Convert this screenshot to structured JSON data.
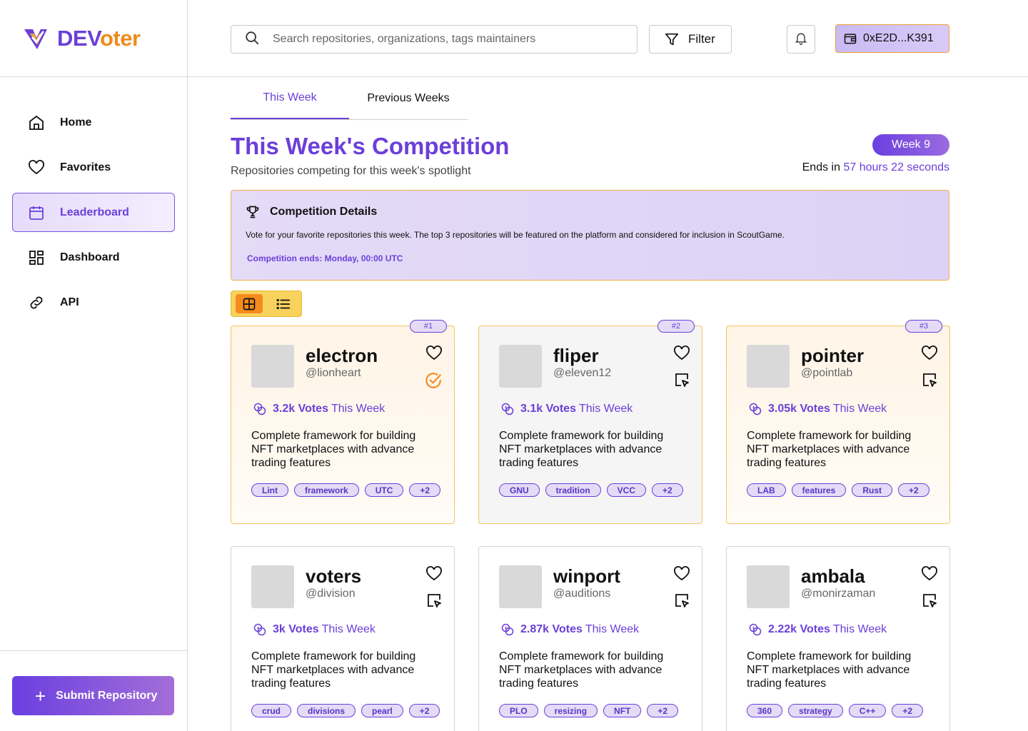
{
  "brand": {
    "name_part1": "DEV",
    "name_part2": "oter"
  },
  "sidebar": {
    "items": [
      {
        "label": "Home",
        "icon": "home-icon"
      },
      {
        "label": "Favorites",
        "icon": "heart-icon"
      },
      {
        "label": "Leaderboard",
        "icon": "calendar-icon",
        "active": true
      },
      {
        "label": "Dashboard",
        "icon": "dashboard-icon"
      },
      {
        "label": "API",
        "icon": "link-icon"
      }
    ],
    "submit_label": "Submit Repository"
  },
  "header": {
    "search_placeholder": "Search repositories, organizations, tags maintainers",
    "filter_label": "Filter",
    "wallet_address": "0xE2D...K391"
  },
  "tabs": [
    {
      "label": "This Week",
      "active": true
    },
    {
      "label": "Previous Weeks"
    }
  ],
  "competition": {
    "title": "This Week's Competition",
    "subtitle": "Repositories competing for this week's spotlight",
    "week_label": "Week 9",
    "ends_prefix": "Ends in",
    "ends_time": "57 hours 22 seconds",
    "details_title": "Competition Details",
    "details_text": "Vote for your favorite repositories this week. The top 3 repositories will be featured on the platform and considered for inclusion in ScoutGame.",
    "details_end": "Competition ends: Monday, 00:00 UTC"
  },
  "vote_suffix": "This Week",
  "cards": [
    {
      "rank": "#1",
      "name": "electron",
      "user": "@lionheart",
      "votes": "3.2k Votes",
      "desc": "Complete framework for building NFT marketplaces with advance trading features",
      "tags": [
        "Lint",
        "framework",
        "UTC",
        "+2"
      ],
      "voted": true
    },
    {
      "rank": "#2",
      "name": "fliper",
      "user": "@eleven12",
      "votes": "3.1k Votes",
      "desc": "Complete framework for building NFT marketplaces with advance trading features",
      "tags": [
        "GNU",
        "tradition",
        "VCC",
        "+2"
      ]
    },
    {
      "rank": "#3",
      "name": "pointer",
      "user": "@pointlab",
      "votes": "3.05k Votes",
      "desc": "Complete framework for building NFT marketplaces with advance trading features",
      "tags": [
        "LAB",
        "features",
        "Rust",
        "+2"
      ]
    },
    {
      "name": "voters",
      "user": "@division",
      "votes": "3k Votes",
      "desc": "Complete framework for building NFT marketplaces with advance trading features",
      "tags": [
        "crud",
        "divisions",
        "pearl",
        "+2"
      ]
    },
    {
      "name": "winport",
      "user": "@auditions",
      "votes": "2.87k Votes",
      "desc": "Complete framework for building NFT marketplaces with advance trading features",
      "tags": [
        "PLO",
        "resizing",
        "NFT",
        "+2"
      ]
    },
    {
      "name": "ambala",
      "user": "@monirzaman",
      "votes": "2.22k Votes",
      "desc": "Complete framework for building NFT marketplaces with advance trading features",
      "tags": [
        "360",
        "strategy",
        "C++",
        "+2"
      ]
    }
  ],
  "colors": {
    "accent": "#6b3fd9",
    "brand_orange": "#f08a1c",
    "highlight": "#f8d25c"
  }
}
